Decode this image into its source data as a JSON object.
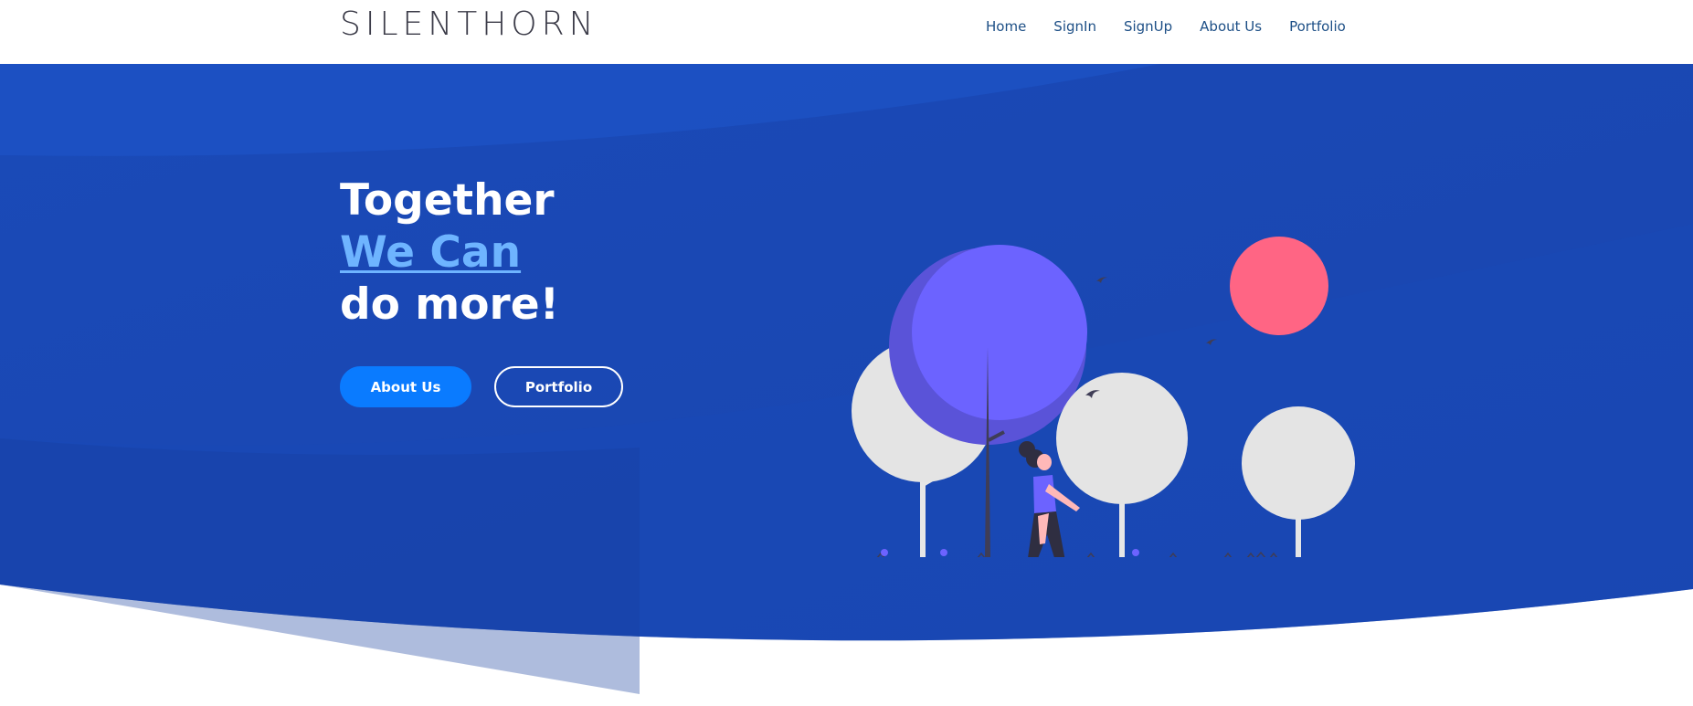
{
  "brand": {
    "name": "SILENTHORN"
  },
  "nav": {
    "items": [
      {
        "label": "Home"
      },
      {
        "label": "SignIn"
      },
      {
        "label": "SignUp"
      },
      {
        "label": "About Us"
      },
      {
        "label": "Portfolio"
      }
    ]
  },
  "hero": {
    "line1": "Together",
    "line2": "We Can",
    "line3": "do more!",
    "primary_button": "About Us",
    "secondary_button": "Portfolio"
  },
  "colors": {
    "hero_blue": "#1744ad",
    "accent_blue": "#0a7bff",
    "highlight_text": "#6eb4ff",
    "tree_purple": "#6c63ff",
    "sun_pink": "#ff6584",
    "nav_text": "#1d4f86"
  },
  "icons": [
    "tree-illustration",
    "sun-circle",
    "bird-icon",
    "walking-woman-figure"
  ]
}
